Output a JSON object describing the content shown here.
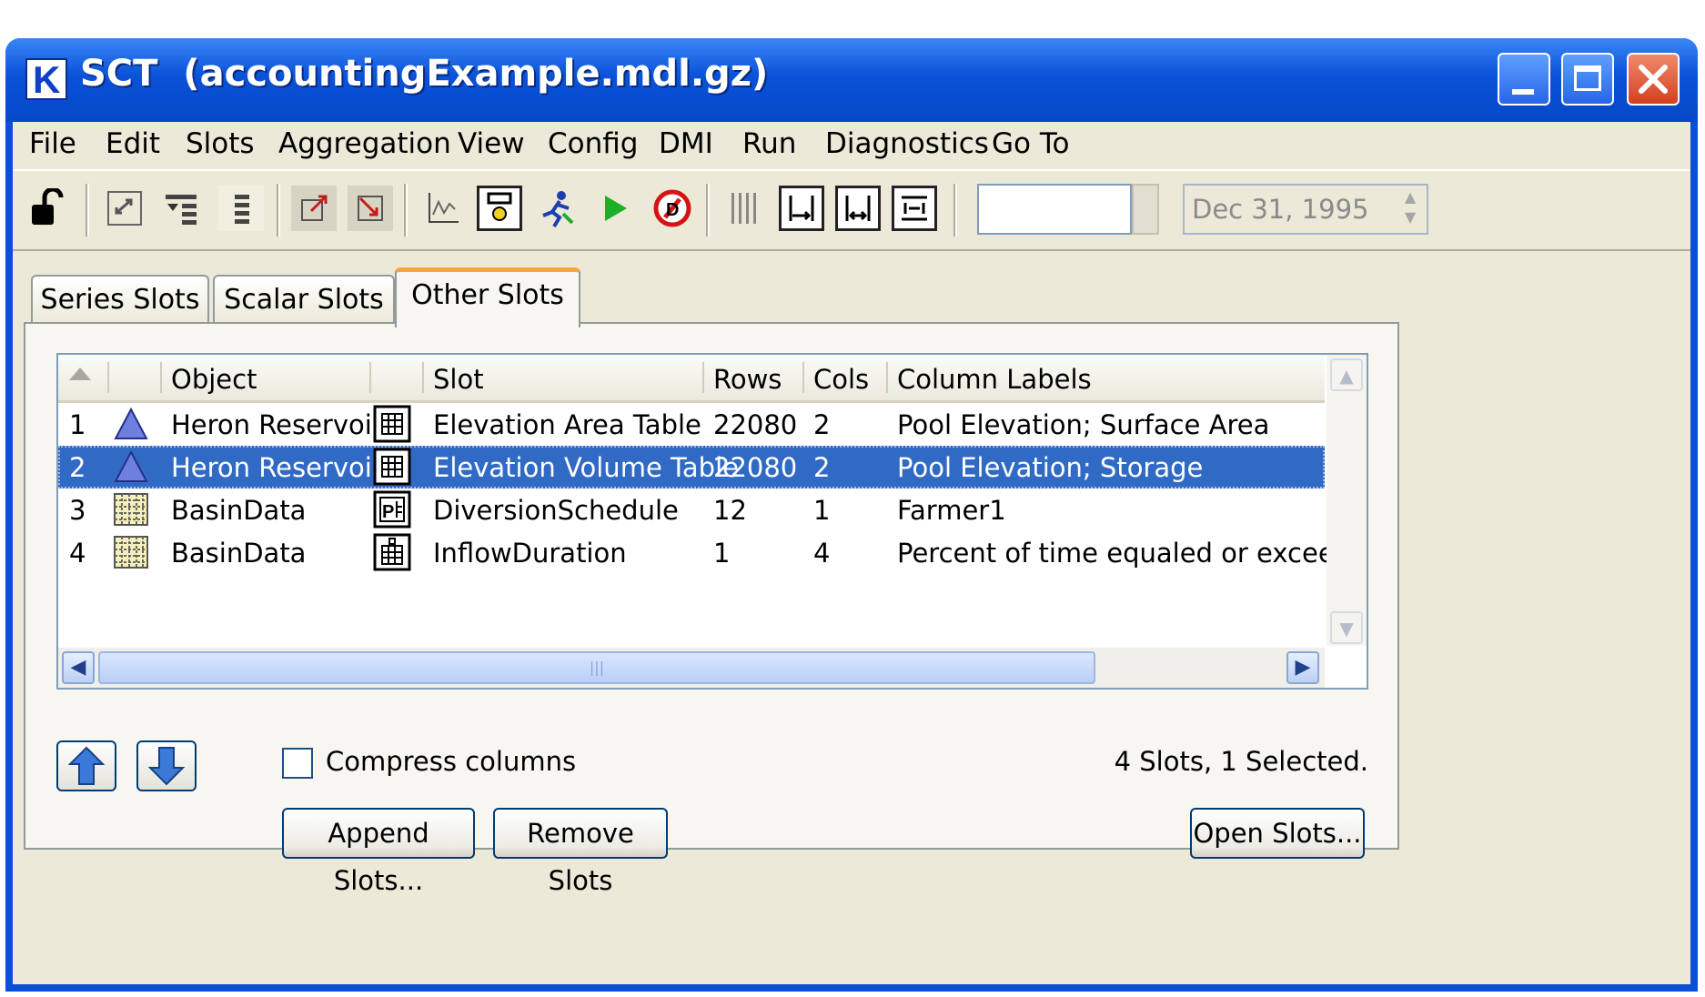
{
  "window": {
    "title": "SCT  (accountingExample.mdl.gz)",
    "app_icon_glyph": "K"
  },
  "menu": [
    "File",
    "Edit",
    "Slots",
    "Aggregation",
    "View",
    "Config",
    "DMI",
    "Run",
    "Diagnostics",
    "Go To"
  ],
  "toolbar": {
    "icons": [
      "lock-icon",
      "swap-icon",
      "filter-icon",
      "column-icon",
      "export-icon",
      "import-icon",
      "plot-icon",
      "object-icon",
      "run-man-icon",
      "play-icon",
      "stop-icon",
      "columns-icon",
      "width-left-icon",
      "width-both-icon",
      "fit-icon"
    ],
    "text_field_value": "",
    "date_value": "Dec 31, 1995"
  },
  "tabs": [
    {
      "label": "Series Slots",
      "active": false
    },
    {
      "label": "Scalar Slots",
      "active": false
    },
    {
      "label": "Other Slots",
      "active": true
    }
  ],
  "table": {
    "headers": [
      "",
      "",
      "Object",
      "",
      "Slot",
      "Rows",
      "Cols",
      "Column Labels"
    ],
    "rows": [
      {
        "num": "1",
        "object_icon": "reservoir-icon",
        "object": "Heron Reservoir",
        "slot_icon": "table-slot-icon",
        "slot": "Elevation Area Table",
        "rows": "22080",
        "cols": "2",
        "labels": "Pool Elevation; Surface Area",
        "selected": false
      },
      {
        "num": "2",
        "object_icon": "reservoir-icon",
        "object": "Heron Reservoir",
        "slot_icon": "table-slot-icon",
        "slot": "Elevation Volume Table",
        "rows": "22080",
        "cols": "2",
        "labels": "Pool Elevation; Storage",
        "selected": true
      },
      {
        "num": "3",
        "object_icon": "data-object-icon",
        "object": "BasinData",
        "slot_icon": "periodic-slot-icon",
        "slot": "DiversionSchedule",
        "rows": "12",
        "cols": "1",
        "labels": "Farmer1",
        "selected": false
      },
      {
        "num": "4",
        "object_icon": "data-object-icon",
        "object": "BasinData",
        "slot_icon": "calendar-slot-icon",
        "slot": "InflowDuration",
        "rows": "1",
        "cols": "4",
        "labels": "Percent of time equaled or exceeded;",
        "selected": false
      }
    ]
  },
  "controls": {
    "compress_label": "Compress columns",
    "compress_checked": false,
    "status": "4 Slots, 1 Selected.",
    "append_label": "Append Slots...",
    "remove_label": "Remove Slots",
    "open_label": "Open Slots..."
  },
  "colors": {
    "selection": "#316ac5",
    "titlebar": "#0a52d8",
    "tab_accent": "#f5a73a"
  }
}
